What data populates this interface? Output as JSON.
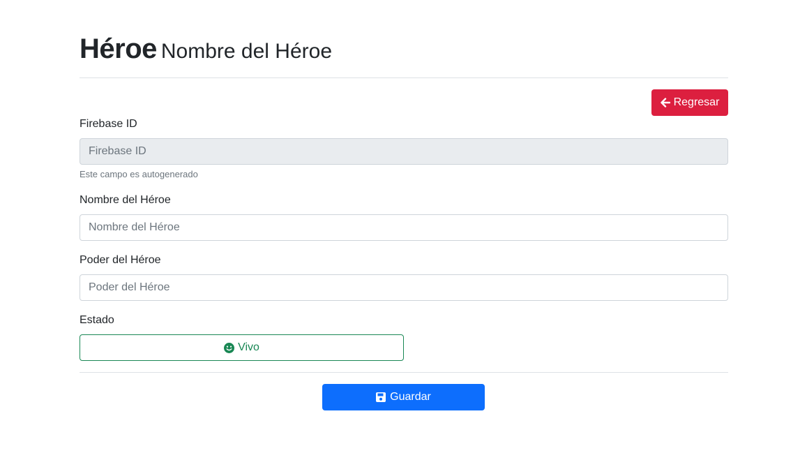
{
  "header": {
    "title": "Héroe",
    "subtitle": "Nombre del Héroe"
  },
  "back_button": {
    "label": "Regresar",
    "icon": "arrow-left-icon",
    "color": "#dc1f3f"
  },
  "form": {
    "firebase_id": {
      "label": "Firebase ID",
      "placeholder": "Firebase ID",
      "value": "",
      "help": "Este campo es autogenerado"
    },
    "name": {
      "label": "Nombre del Héroe",
      "placeholder": "Nombre del Héroe",
      "value": ""
    },
    "power": {
      "label": "Poder del Héroe",
      "placeholder": "Poder del Héroe",
      "value": ""
    },
    "status": {
      "label": "Estado",
      "button_label": "Vivo",
      "icon": "smile-icon",
      "color": "#198754"
    }
  },
  "save_button": {
    "label": "Guardar",
    "icon": "save-icon",
    "color": "#0d6efd"
  }
}
